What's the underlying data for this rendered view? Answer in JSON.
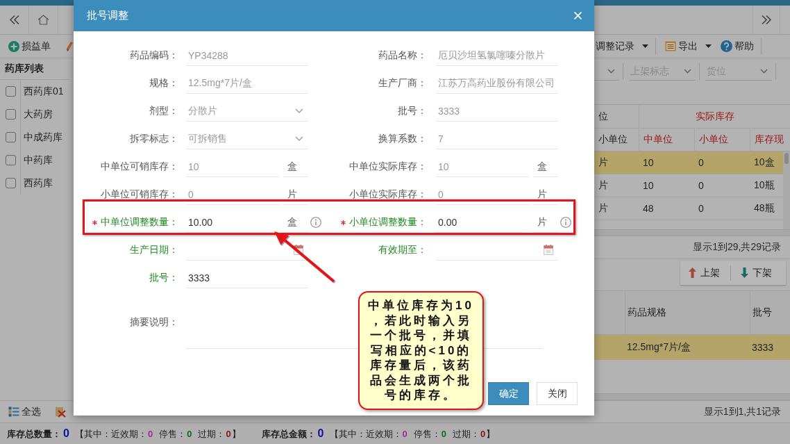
{
  "toolbar": {
    "left": [
      {
        "label": "损益单",
        "kind": "add"
      }
    ],
    "right": [
      {
        "label": "调整记录",
        "kind": "records"
      },
      {
        "label": "导出",
        "kind": "export"
      },
      {
        "label": "帮助",
        "kind": "help"
      }
    ]
  },
  "warehouse_list": {
    "title": "药库列表",
    "items": [
      {
        "label": "西药库01",
        "checked": false
      },
      {
        "label": "大药房",
        "checked": false
      },
      {
        "label": "中成药库",
        "checked": false
      },
      {
        "label": "中药库",
        "checked": false
      },
      {
        "label": "西药库",
        "checked": false
      }
    ]
  },
  "filters": [
    {
      "placeholder": "上架标志"
    },
    {
      "placeholder": "货位"
    }
  ],
  "stock_table": {
    "group_headers": [
      {
        "label": "位",
        "kind": "base"
      },
      {
        "label": "实际库存",
        "kind": "actual"
      }
    ],
    "columns": [
      {
        "label": "小单位",
        "kind": "base"
      },
      {
        "label": "中单位",
        "kind": "actual"
      },
      {
        "label": "小单位",
        "kind": "actual"
      },
      {
        "label": "库存现",
        "kind": "actual"
      }
    ],
    "rows": [
      {
        "selected": true,
        "cells": [
          "片",
          "10",
          "0",
          "10盒"
        ]
      },
      {
        "selected": false,
        "cells": [
          "片",
          "10",
          "0",
          "10瓶"
        ]
      },
      {
        "selected": false,
        "cells": [
          "片",
          "48",
          "0",
          "48瓶"
        ]
      }
    ],
    "pager": "显示1到29,共29记录"
  },
  "shelf_actions": [
    {
      "label": "上架",
      "kind": "up"
    },
    {
      "label": "下架",
      "kind": "down"
    }
  ],
  "batch_table": {
    "columns": [
      {
        "label": "药品规格"
      },
      {
        "label": "批号"
      }
    ],
    "rows": [
      {
        "selected": true,
        "cells": [
          "12.5mg*7片/盒",
          "3333"
        ]
      }
    ],
    "pager": "显示1到1,共1记录"
  },
  "bottom_actions": [
    {
      "label": "全选",
      "kind": "select-all"
    }
  ],
  "summary": [
    {
      "label": "库存总数量：",
      "value": "0",
      "open": "【其中：",
      "parts": [
        {
          "label": "近效期：",
          "value": "0",
          "color": "#a8279a"
        },
        {
          "label": "停售：",
          "value": "0",
          "color": "#146b14"
        },
        {
          "label": "过期：",
          "value": "0",
          "color": "#8e1010"
        }
      ],
      "close": "】"
    },
    {
      "label": "库存总金额：",
      "value": "0",
      "open": "【其中：",
      "parts": [
        {
          "label": "近效期：",
          "value": "0",
          "color": "#a8279a"
        },
        {
          "label": "停售：",
          "value": "0",
          "color": "#146b14"
        },
        {
          "label": "过期：",
          "value": "0",
          "color": "#8e1010"
        }
      ],
      "close": "】"
    }
  ],
  "dialog": {
    "title": "批号调整",
    "rows": [
      {
        "fields": [
          {
            "label": "药品编码：",
            "kind": "text",
            "value": "YP34288",
            "readonly": true,
            "required": false,
            "emphasis": false,
            "info": false
          },
          {
            "label": "药品名称：",
            "kind": "text",
            "value": "厄贝沙坦氢氯噻嗪分散片",
            "readonly": true,
            "required": false,
            "emphasis": false,
            "info": false
          }
        ]
      },
      {
        "fields": [
          {
            "label": "规格：",
            "kind": "text",
            "value": "12.5mg*7片/盒",
            "readonly": true,
            "required": false,
            "emphasis": false,
            "info": false
          },
          {
            "label": "生产厂商：",
            "kind": "text",
            "value": "江苏万高药业股份有限公司",
            "readonly": true,
            "required": false,
            "emphasis": false,
            "info": false
          }
        ]
      },
      {
        "fields": [
          {
            "label": "剂型：",
            "kind": "select",
            "value": "分散片",
            "readonly": true,
            "required": false,
            "emphasis": false,
            "info": false
          },
          {
            "label": "批号：",
            "kind": "text",
            "value": "3333",
            "readonly": true,
            "required": false,
            "emphasis": false,
            "info": false
          }
        ]
      },
      {
        "fields": [
          {
            "label": "拆零标志：",
            "kind": "select",
            "value": "可拆销售",
            "readonly": true,
            "required": false,
            "emphasis": false,
            "info": false
          },
          {
            "label": "换算系数：",
            "kind": "text",
            "value": "7",
            "readonly": true,
            "required": false,
            "emphasis": false,
            "info": false
          }
        ]
      },
      {
        "fields": [
          {
            "label": "中单位可销库存：",
            "kind": "unit",
            "value": "10",
            "unit": "盒",
            "readonly": true,
            "required": false,
            "emphasis": false,
            "info": false
          },
          {
            "label": "中单位实际库存：",
            "kind": "unit",
            "value": "10",
            "unit": "盒",
            "readonly": true,
            "required": false,
            "emphasis": false,
            "info": false
          }
        ]
      },
      {
        "fields": [
          {
            "label": "小单位可销库存：",
            "kind": "unit",
            "value": "0",
            "unit": "片",
            "readonly": true,
            "required": false,
            "emphasis": false,
            "info": false
          },
          {
            "label": "小单位实际库存：",
            "kind": "unit",
            "value": "0",
            "unit": "片",
            "readonly": true,
            "required": false,
            "emphasis": false,
            "info": false
          }
        ]
      },
      {
        "fields": [
          {
            "label": "中单位调整数量：",
            "kind": "unit",
            "value": "10.00",
            "unit": "盒",
            "readonly": false,
            "required": true,
            "emphasis": true,
            "info": true
          },
          {
            "label": "小单位调整数量：",
            "kind": "unit",
            "value": "0.00",
            "unit": "片",
            "readonly": false,
            "required": true,
            "emphasis": true,
            "info": true
          }
        ]
      },
      {
        "fields": [
          {
            "label": "生产日期：",
            "kind": "date",
            "required": false,
            "emphasis": true,
            "info": false
          },
          {
            "label": "有效期至：",
            "kind": "date",
            "required": false,
            "emphasis": true,
            "info": false
          }
        ]
      },
      {
        "fields": [
          {
            "label": "批号：",
            "kind": "text",
            "value": "3333",
            "readonly": false,
            "required": false,
            "emphasis": true,
            "info": false
          }
        ]
      },
      {
        "fields": [
          {
            "label": "摘要说明：",
            "kind": "textarea",
            "required": false,
            "emphasis": false,
            "info": false
          }
        ]
      }
    ],
    "buttons": [
      {
        "label": "确定",
        "kind": "primary"
      },
      {
        "label": "关闭",
        "kind": "default"
      }
    ]
  },
  "annotation": {
    "callout": "中单位库存为10，若此时输入另一个批号，并填写相应的<10的库存量后，该药品会生成两个批号的库存。"
  }
}
